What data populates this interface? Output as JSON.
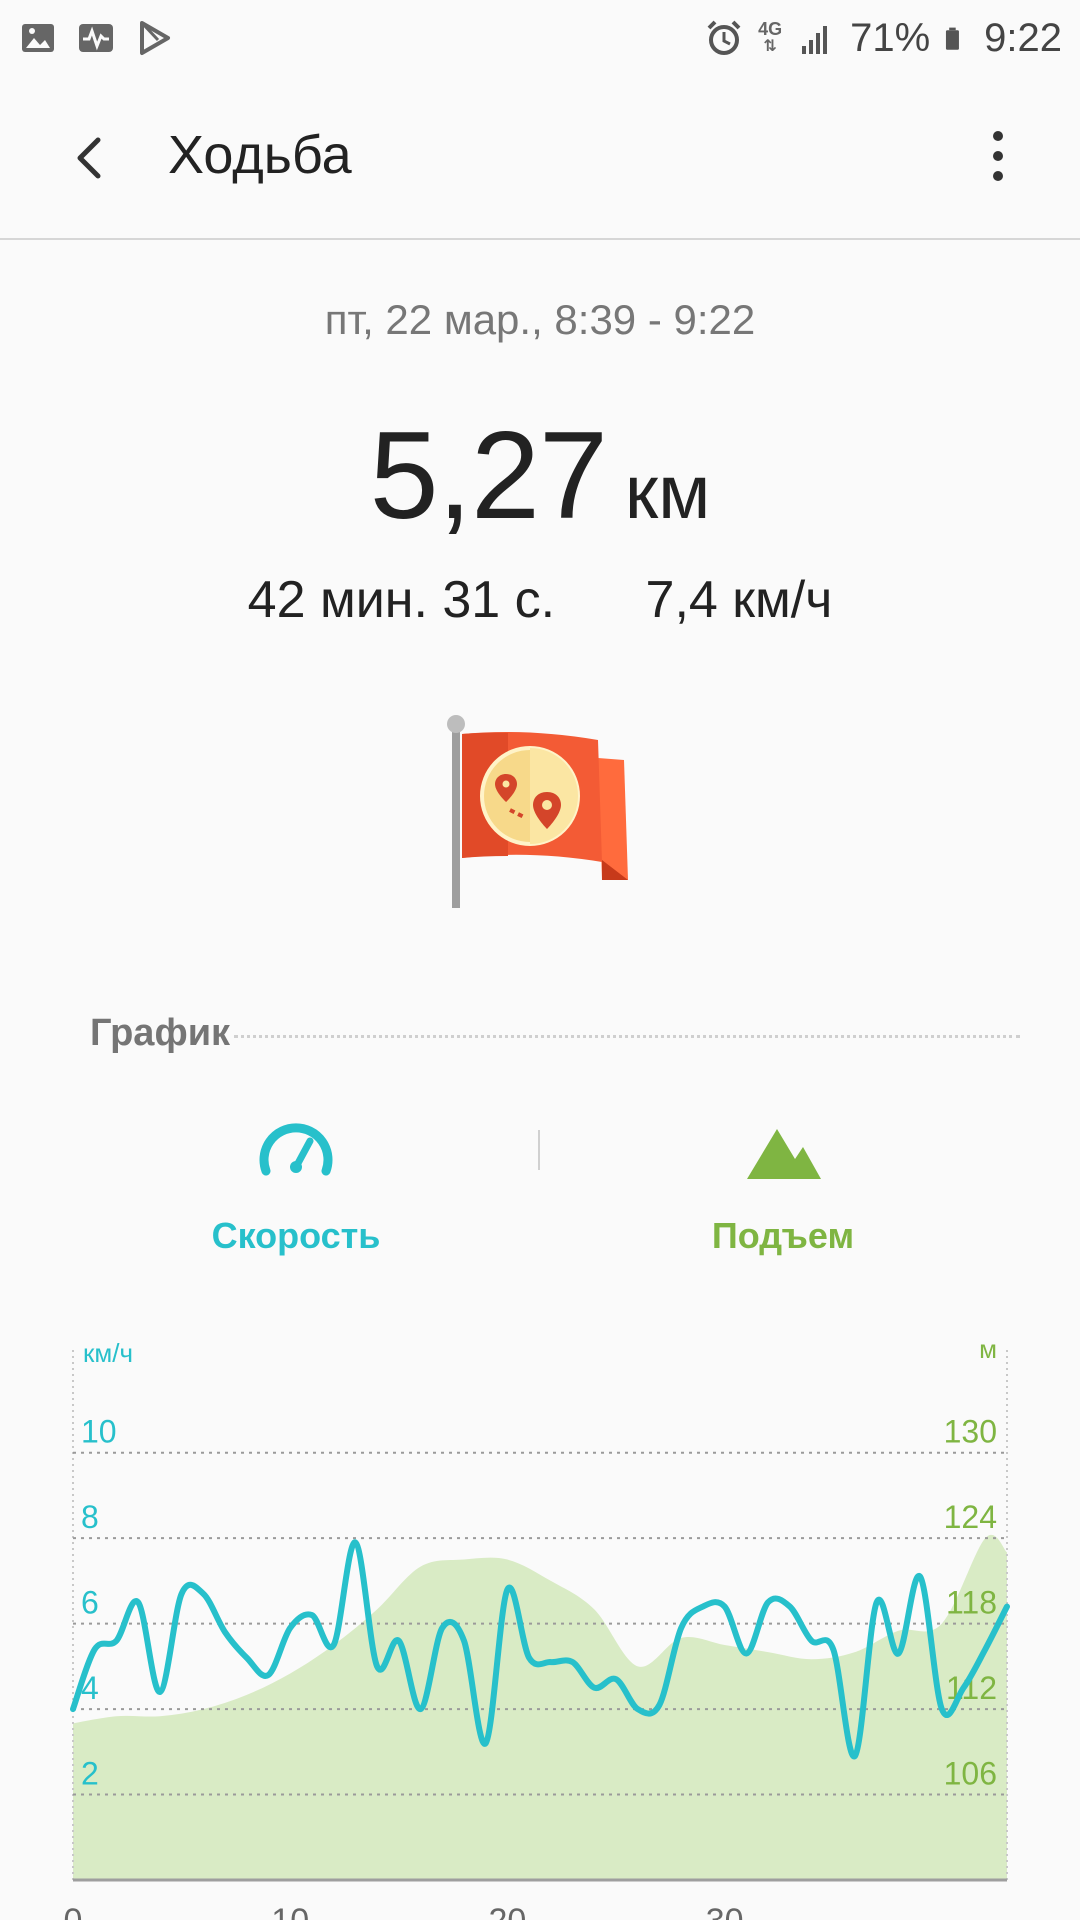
{
  "status_bar": {
    "battery_text": "71%",
    "time": "9:22",
    "network_label": "4G",
    "icons": [
      "image-icon",
      "activity-icon",
      "play-store-icon",
      "alarm-icon",
      "signal-icon",
      "battery-icon"
    ]
  },
  "app_bar": {
    "title": "Ходьба",
    "back_icon": "back-arrow-icon",
    "menu_icon": "more-vert-icon"
  },
  "workout": {
    "date_range": "пт, 22 мар., 8:39 - 9:22",
    "distance_value": "5,27",
    "distance_unit": "км",
    "duration": "42 мин. 31 с.",
    "avg_speed": "7,4 км/ч",
    "badge_icon": "route-flag-icon"
  },
  "graph_section": {
    "title": "График",
    "metrics": [
      {
        "label": "Скорость",
        "icon": "speedometer-icon",
        "color": "#27c0cb"
      },
      {
        "label": "Подъем",
        "icon": "mountain-icon",
        "color": "#7fb542"
      }
    ]
  },
  "chart_data": {
    "type": "line",
    "left_axis": {
      "unit_label": "км/ч",
      "ticks": [
        "10",
        "8",
        "6",
        "4",
        "2"
      ],
      "range": [
        0,
        11
      ]
    },
    "right_axis": {
      "unit_label": "м",
      "ticks": [
        "130",
        "124",
        "118",
        "112",
        "106"
      ],
      "range": [
        100,
        133
      ]
    },
    "x_ticks": [
      "0",
      "10",
      "20",
      "30"
    ],
    "x_range": [
      0,
      43
    ],
    "series": [
      {
        "kind": "line",
        "axis": "left",
        "color": "#27c0cb",
        "x": [
          0,
          1,
          2,
          3,
          4,
          5,
          6,
          7,
          8,
          9,
          10,
          11,
          12,
          13,
          14,
          15,
          16,
          17,
          18,
          19,
          20,
          21,
          22,
          23,
          24,
          25,
          26,
          27,
          28,
          29,
          30,
          31,
          32,
          33,
          34,
          35,
          36,
          37,
          38,
          39,
          40,
          41,
          42,
          43
        ],
        "y": [
          4.0,
          5.4,
          5.6,
          6.5,
          4.4,
          6.7,
          6.7,
          5.8,
          5.2,
          4.8,
          5.9,
          6.2,
          5.5,
          7.9,
          5.0,
          5.6,
          4.0,
          5.9,
          5.6,
          3.2,
          6.8,
          5.2,
          5.1,
          5.1,
          4.5,
          4.7,
          4.0,
          4.1,
          5.9,
          6.4,
          6.4,
          5.3,
          6.5,
          6.4,
          5.6,
          5.4,
          2.9,
          6.5,
          5.3,
          7.1,
          4.0,
          4.5,
          5.4,
          6.4
        ]
      },
      {
        "kind": "area",
        "axis": "right",
        "color": "#d9ebc5",
        "x": [
          0,
          2,
          4,
          6,
          8,
          10,
          12,
          14,
          16,
          18,
          20,
          22,
          24,
          26,
          28,
          30,
          32,
          34,
          36,
          38,
          40,
          42,
          43
        ],
        "y": [
          111,
          111.5,
          111.5,
          112,
          113,
          114.5,
          116.5,
          119,
          122,
          122.5,
          122.5,
          121,
          119,
          115,
          117,
          116.5,
          116,
          115.5,
          116,
          117.5,
          118,
          124,
          123
        ]
      }
    ]
  }
}
